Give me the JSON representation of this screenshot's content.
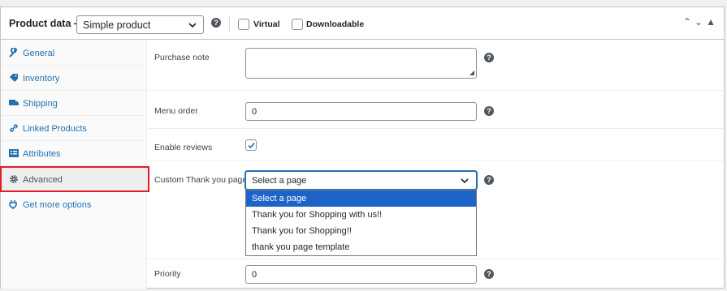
{
  "header": {
    "title": "Product data —",
    "product_type": "Simple product",
    "virtual_label": "Virtual",
    "downloadable_label": "Downloadable"
  },
  "sidebar": {
    "items": [
      {
        "label": "General",
        "icon": "wrench-icon"
      },
      {
        "label": "Inventory",
        "icon": "tag-icon"
      },
      {
        "label": "Shipping",
        "icon": "truck-icon"
      },
      {
        "label": "Linked Products",
        "icon": "link-icon"
      },
      {
        "label": "Attributes",
        "icon": "list-icon"
      },
      {
        "label": "Advanced",
        "icon": "gear-icon"
      },
      {
        "label": "Get more options",
        "icon": "plugin-icon"
      }
    ]
  },
  "fields": {
    "purchase_note": {
      "label": "Purchase note",
      "value": ""
    },
    "menu_order": {
      "label": "Menu order",
      "value": "0"
    },
    "enable_reviews": {
      "label": "Enable reviews",
      "checked": true
    },
    "custom_thank_you": {
      "label": "Custom Thank you page",
      "selected": "Select a page",
      "options": [
        "Select a page",
        "Thank you for Shopping with us!!",
        "Thank you for Shopping!!",
        "thank you page template"
      ]
    },
    "priority": {
      "label": "Priority",
      "value": "0"
    }
  },
  "colors": {
    "link": "#2271b1",
    "highlight": "#e01e26",
    "selected_option": "#1e64c8"
  }
}
